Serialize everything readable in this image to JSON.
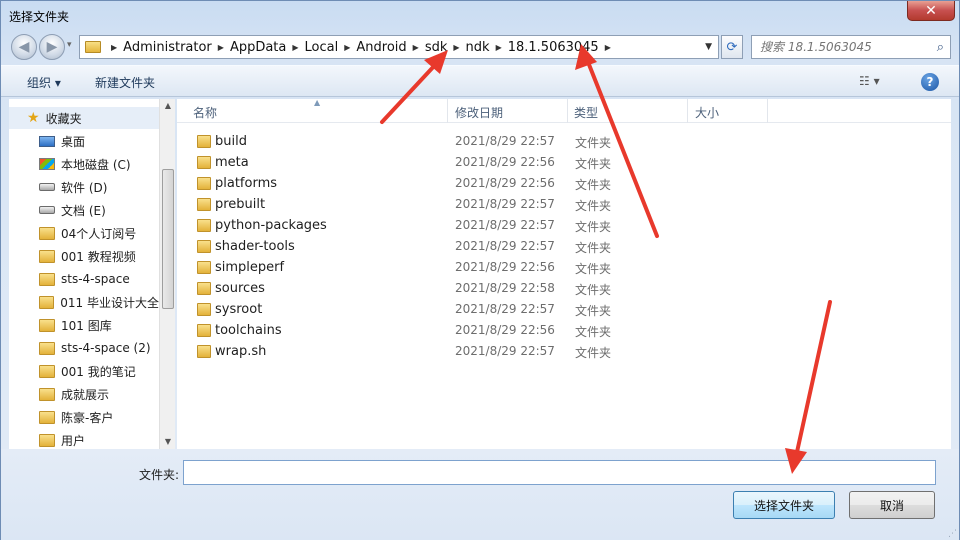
{
  "window": {
    "title": "选择文件夹",
    "close_label": "✕"
  },
  "address": {
    "crumbs": [
      "Administrator",
      "AppData",
      "Local",
      "Android",
      "sdk",
      "ndk",
      "18.1.5063045"
    ],
    "search_placeholder": "搜索 18.1.5063045"
  },
  "toolbar": {
    "organize_label": "组织 ▾",
    "new_folder_label": "新建文件夹",
    "views_label": "☷ ▾",
    "help_label": "?"
  },
  "navpane": {
    "items": [
      {
        "label": "收藏夹",
        "icon": "star-icon"
      },
      {
        "label": "桌面",
        "icon": "desktop-icon"
      },
      {
        "label": "本地磁盘 (C)",
        "icon": "system-drive-icon"
      },
      {
        "label": "软件 (D)",
        "icon": "drive-icon"
      },
      {
        "label": "文档 (E)",
        "icon": "drive-icon"
      },
      {
        "label": "04个人订阅号",
        "icon": "folder-icon"
      },
      {
        "label": "001 教程视频",
        "icon": "folder-icon"
      },
      {
        "label": "sts-4-space",
        "icon": "folder-icon"
      },
      {
        "label": "011 毕业设计大全",
        "icon": "folder-icon"
      },
      {
        "label": "101 图库",
        "icon": "folder-icon"
      },
      {
        "label": "sts-4-space (2)",
        "icon": "folder-icon"
      },
      {
        "label": "001 我的笔记",
        "icon": "folder-icon"
      },
      {
        "label": "成就展示",
        "icon": "folder-icon"
      },
      {
        "label": "陈豪-客户",
        "icon": "folder-icon"
      },
      {
        "label": "用户",
        "icon": "folder-icon"
      }
    ]
  },
  "filelist": {
    "columns": {
      "name": "名称",
      "modified": "修改日期",
      "type": "类型",
      "size": "大小"
    },
    "rows": [
      {
        "name": "build",
        "modified": "2021/8/29 22:57",
        "type": "文件夹"
      },
      {
        "name": "meta",
        "modified": "2021/8/29 22:56",
        "type": "文件夹"
      },
      {
        "name": "platforms",
        "modified": "2021/8/29 22:56",
        "type": "文件夹"
      },
      {
        "name": "prebuilt",
        "modified": "2021/8/29 22:57",
        "type": "文件夹"
      },
      {
        "name": "python-packages",
        "modified": "2021/8/29 22:57",
        "type": "文件夹"
      },
      {
        "name": "shader-tools",
        "modified": "2021/8/29 22:57",
        "type": "文件夹"
      },
      {
        "name": "simpleperf",
        "modified": "2021/8/29 22:56",
        "type": "文件夹"
      },
      {
        "name": "sources",
        "modified": "2021/8/29 22:58",
        "type": "文件夹"
      },
      {
        "name": "sysroot",
        "modified": "2021/8/29 22:57",
        "type": "文件夹"
      },
      {
        "name": "toolchains",
        "modified": "2021/8/29 22:56",
        "type": "文件夹"
      },
      {
        "name": "wrap.sh",
        "modified": "2021/8/29 22:57",
        "type": "文件夹"
      }
    ]
  },
  "footer": {
    "folder_label": "文件夹:",
    "folder_value": "",
    "select_button": "选择文件夹",
    "cancel_button": "取消"
  },
  "colors": {
    "annotation_arrow": "#e8392c",
    "accent": "#3c7fb1"
  }
}
